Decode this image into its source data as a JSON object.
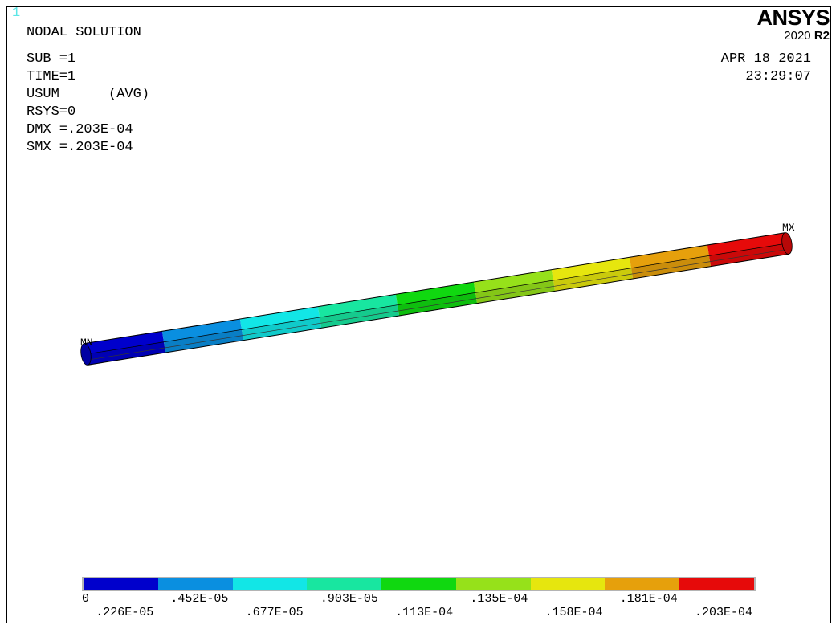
{
  "window_number": "1",
  "brand": {
    "name": "ANSYS",
    "version_year": "2020",
    "version_release": "R2"
  },
  "info": [
    "NODAL SOLUTION",
    "SUB =1",
    "TIME=1",
    "USUM      (AVG)",
    "RSYS=0",
    "DMX =.203E-04",
    "SMX =.203E-04"
  ],
  "date": "APR 18 2021",
  "time": "23:29:07",
  "markers": {
    "min": "MN",
    "max": "MX"
  },
  "legend": {
    "colors": [
      "#0000cc",
      "#0a8fe0",
      "#12e6e6",
      "#18e6a0",
      "#10d810",
      "#96e11a",
      "#e6e60e",
      "#e6a00c",
      "#e60a0a"
    ],
    "top_ticks": [
      "0",
      ".452E-05",
      ".903E-05",
      ".135E-04",
      ".181E-04"
    ],
    "bottom_ticks": [
      ".226E-05",
      ".677E-05",
      ".113E-04",
      ".158E-04",
      ".203E-04"
    ]
  }
}
